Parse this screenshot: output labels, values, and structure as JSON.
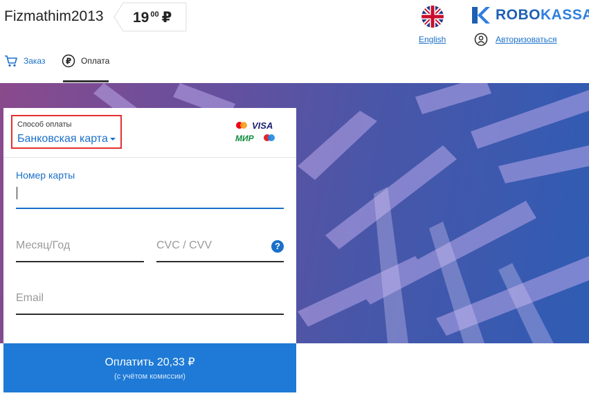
{
  "header": {
    "merchant": "Fizmathim2013",
    "price": {
      "whole": "19",
      "cents": "00",
      "currency": "₽"
    },
    "language": "English",
    "logo": {
      "part1": "ROBO",
      "part2": "KASSA"
    },
    "auth": "Авторизоваться"
  },
  "tabs": [
    {
      "label": "Заказ",
      "icon": "cart-icon"
    },
    {
      "label": "Оплата",
      "icon": "ruble-circle-icon",
      "active": true
    }
  ],
  "form": {
    "method_label": "Способ оплаты",
    "method_value": "Банковская карта",
    "card_number_label": "Номер карты",
    "expiry_placeholder": "Месяц/Год",
    "cvc_placeholder": "CVC / CVV",
    "email_placeholder": "Email",
    "help_symbol": "?"
  },
  "card_brands": {
    "visa": "VISA",
    "mir": "МИР"
  },
  "pay_button": {
    "label": "Оплатить 20,33 ₽",
    "sub": "(с учётом комиссии)"
  },
  "colors": {
    "accent": "#1a6fc9",
    "button": "#1e7ad6",
    "highlight_border": "#e52d2d"
  }
}
